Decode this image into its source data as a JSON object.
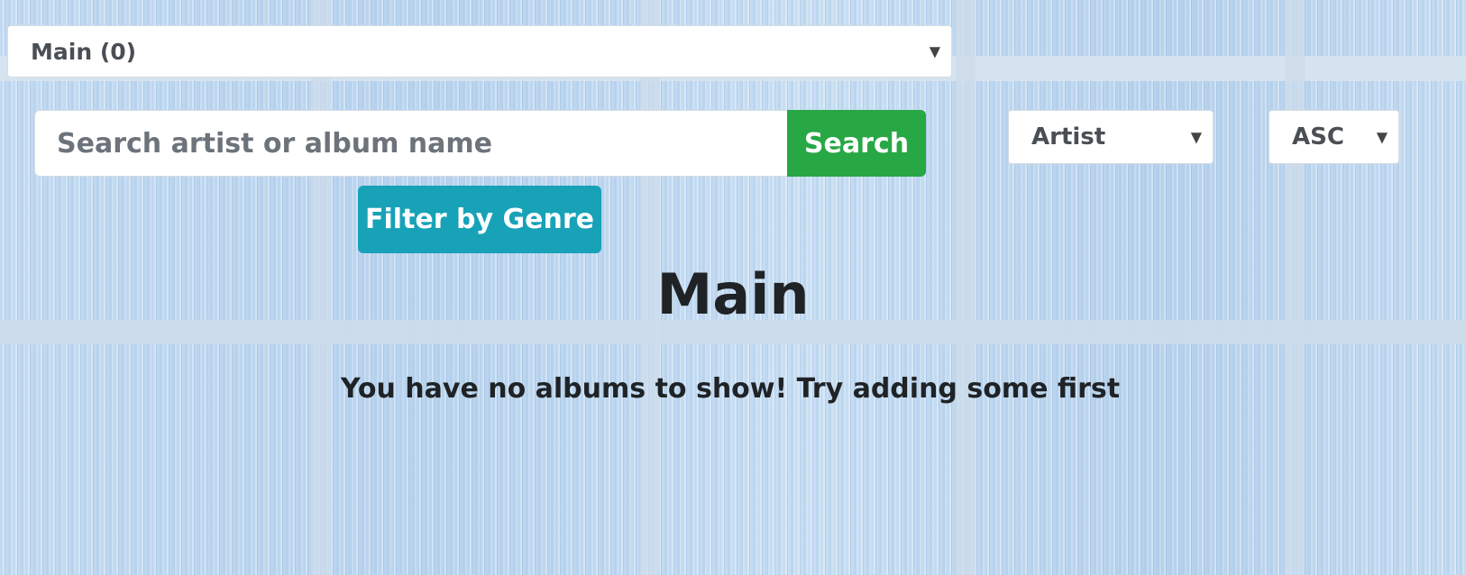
{
  "collection_select": {
    "selected": "Main (0)",
    "caret_icon": "chevron-down-icon"
  },
  "search": {
    "placeholder": "Search artist or album name",
    "value": "",
    "button_label": "Search"
  },
  "filter": {
    "button_label": "Filter by Genre"
  },
  "sort": {
    "field_selected": "Artist",
    "order_selected": "ASC"
  },
  "main": {
    "title": "Main",
    "empty_message": "You have no albums to show! Try adding some first"
  },
  "colors": {
    "search_button": "#28a745",
    "filter_button": "#17a2b8",
    "background": "#bcd6ef",
    "text_dark": "#1f2326"
  }
}
